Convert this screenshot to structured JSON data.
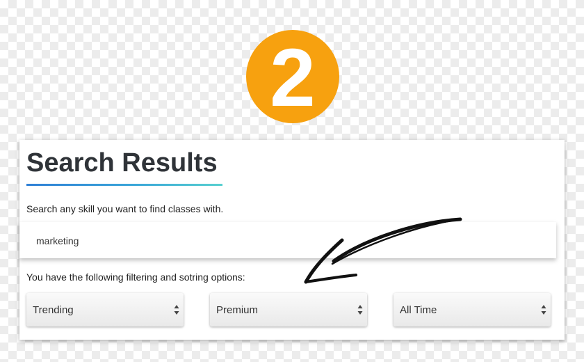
{
  "badge": {
    "number": "2"
  },
  "header": {
    "title": "Search Results"
  },
  "search": {
    "instructions": "Search any skill you want to find classes with.",
    "value": "marketing"
  },
  "filters": {
    "intro": "You have the following filtering and sotring options:",
    "selects": [
      {
        "value": "Trending"
      },
      {
        "value": "Premium"
      },
      {
        "value": "All Time"
      }
    ]
  },
  "colors": {
    "badge": "#f7a10f",
    "title": "#2f3338",
    "underline_start": "#2f7fd6",
    "underline_end": "#58d0d0"
  },
  "icons": {
    "select_arrows": "updown-caret-icon",
    "annotation": "hand-drawn-arrow-icon"
  }
}
